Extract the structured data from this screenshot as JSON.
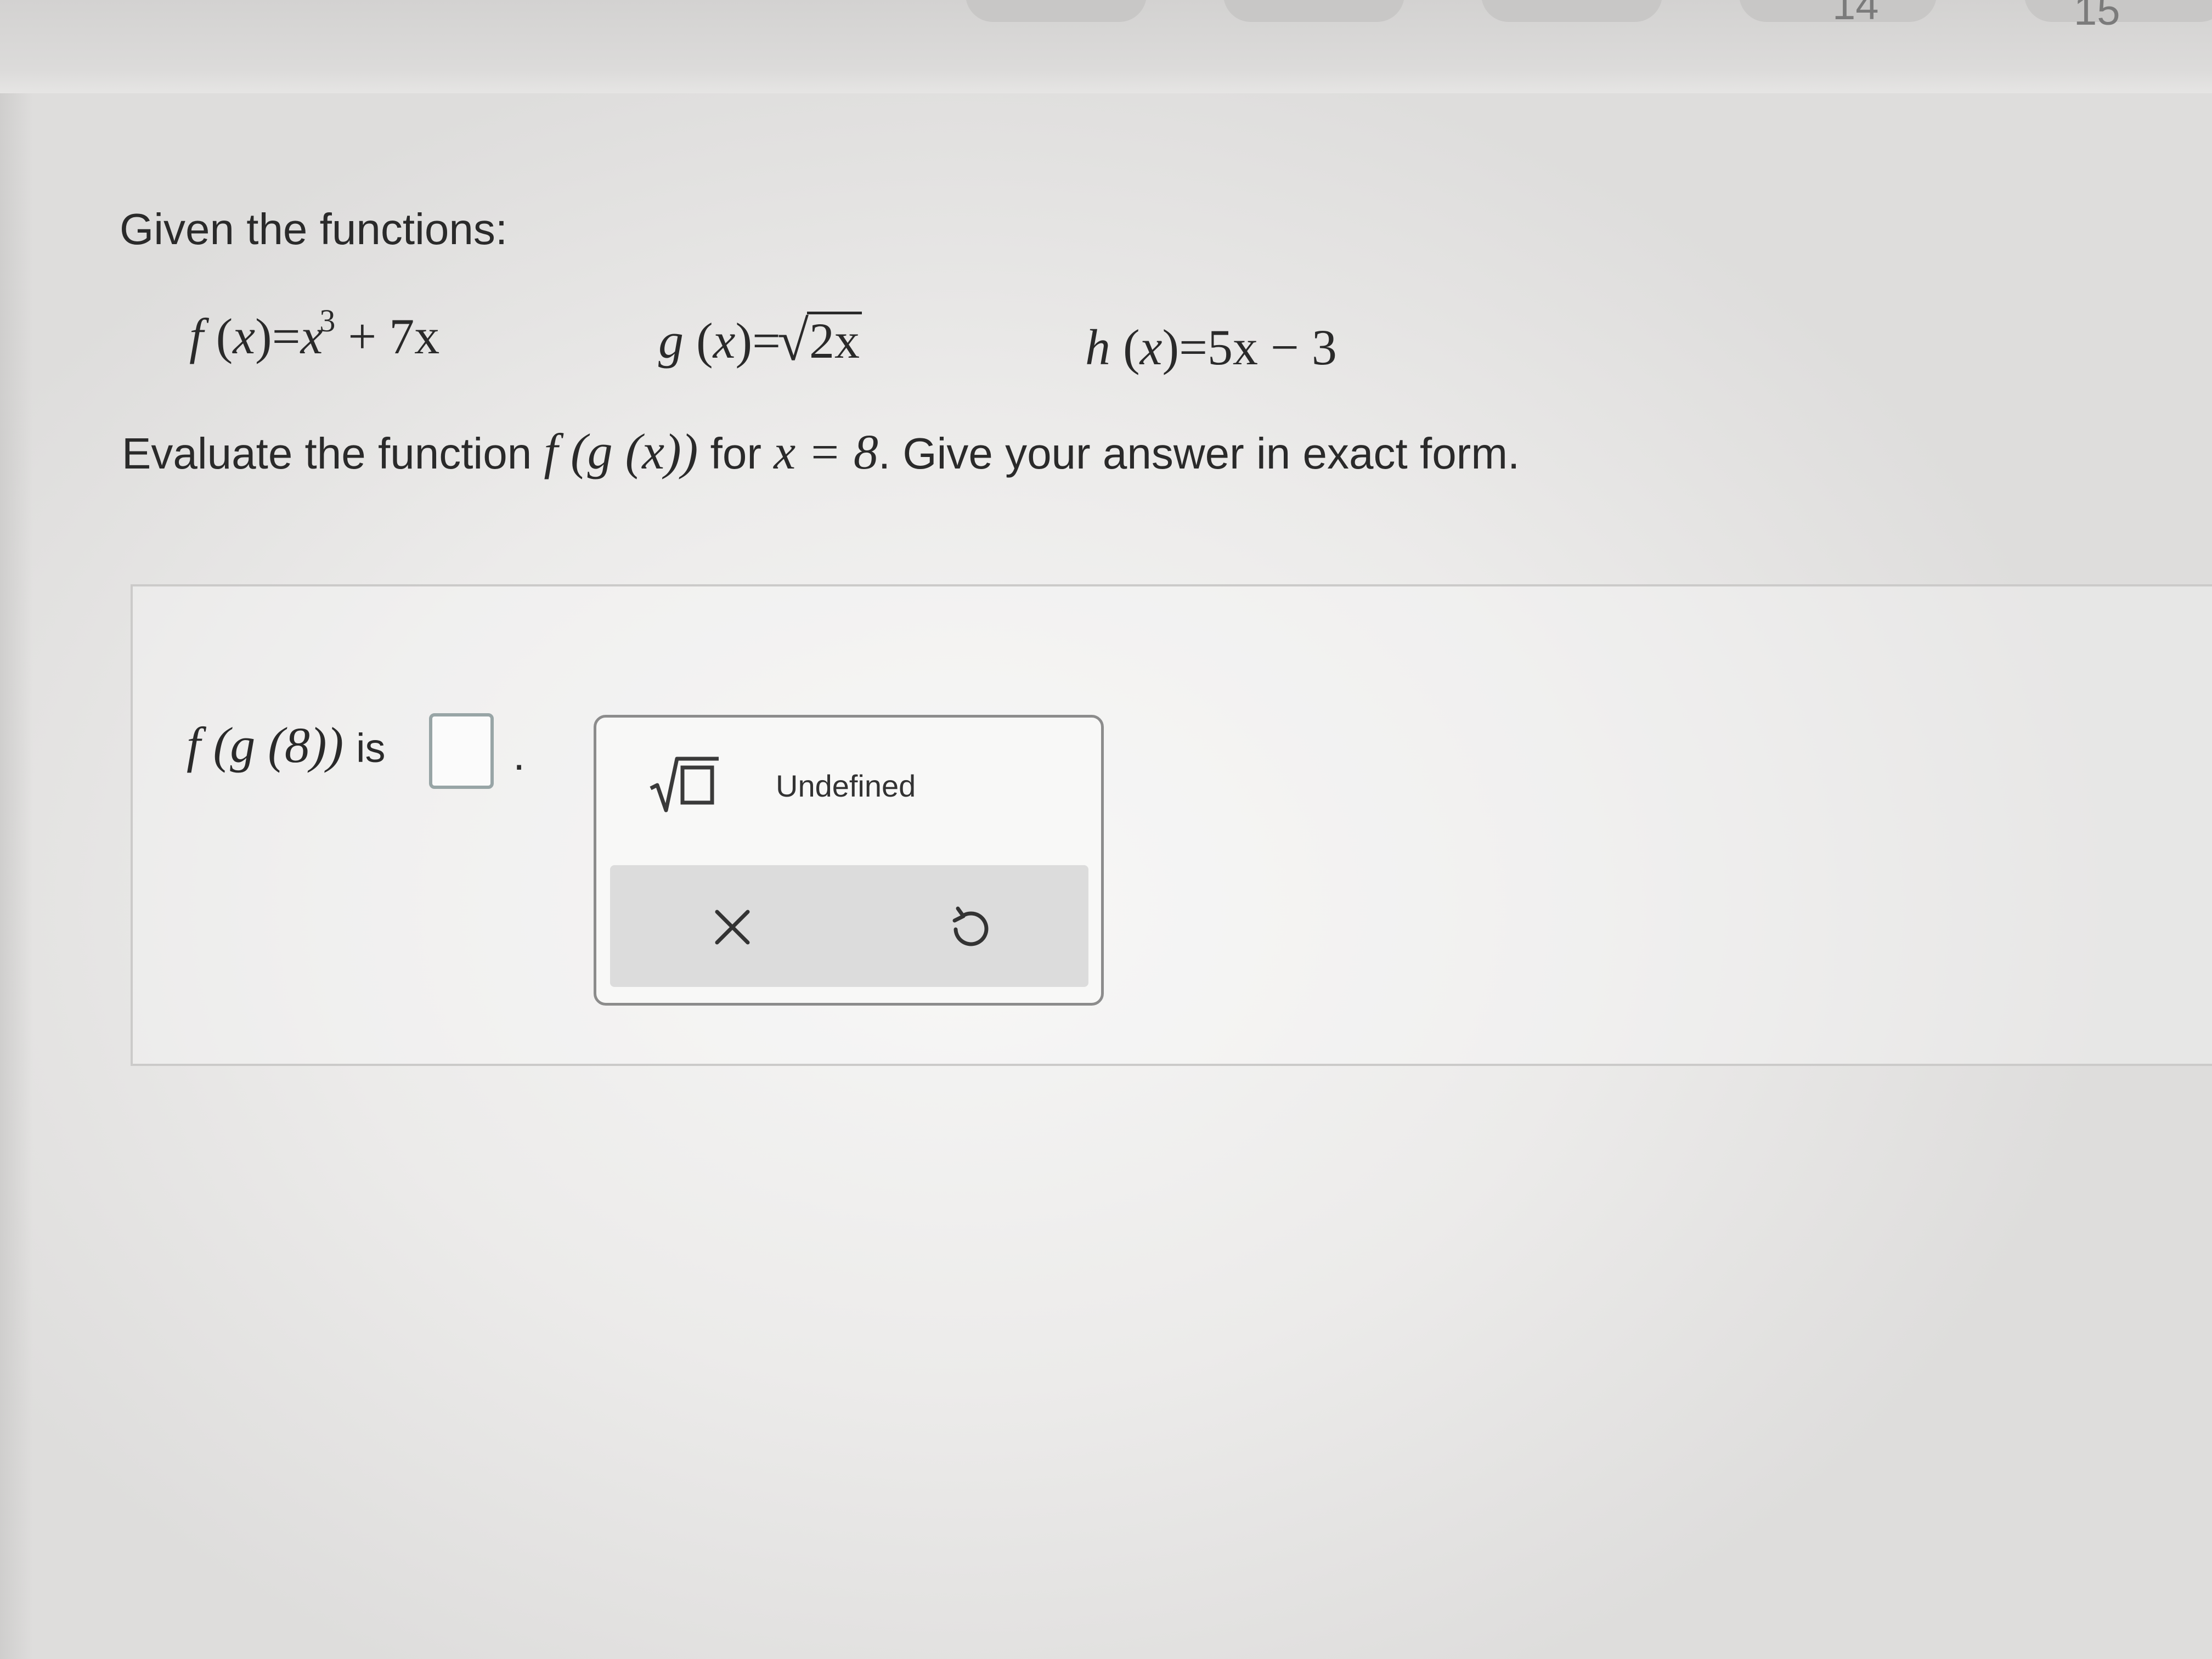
{
  "nav": {
    "question_numbers": [
      "14",
      "15"
    ]
  },
  "question": {
    "intro": "Given the functions:",
    "f_def": {
      "lhs": "f",
      "var": "x",
      "eq": "=",
      "term1": "x",
      "exp": "3",
      "rest": "+ 7x"
    },
    "g_def": {
      "lhs": "g",
      "var": "x",
      "eq": "=",
      "radicand": "2x"
    },
    "h_def": {
      "lhs": "h",
      "var": "x",
      "eq": "=",
      "rhs": "5x − 3"
    },
    "prompt_start": "Evaluate the function",
    "prompt_composite": "f (g (x))",
    "prompt_for": "for",
    "prompt_condition": "x = 8",
    "prompt_end": ". Give your answer in exact form."
  },
  "answer": {
    "label_math": "f (g (8))",
    "label_text": "is",
    "value": "",
    "suffix": "."
  },
  "keypad": {
    "sqrt_icon": "square-root-template-icon",
    "undefined_label": "Undefined",
    "clear_icon": "close-icon",
    "undo_icon": "undo-icon"
  },
  "colors": {
    "text": "#2a2a2a",
    "answer_box_border": "#98a5a6",
    "keypad_bar": "#dcdcdc"
  }
}
